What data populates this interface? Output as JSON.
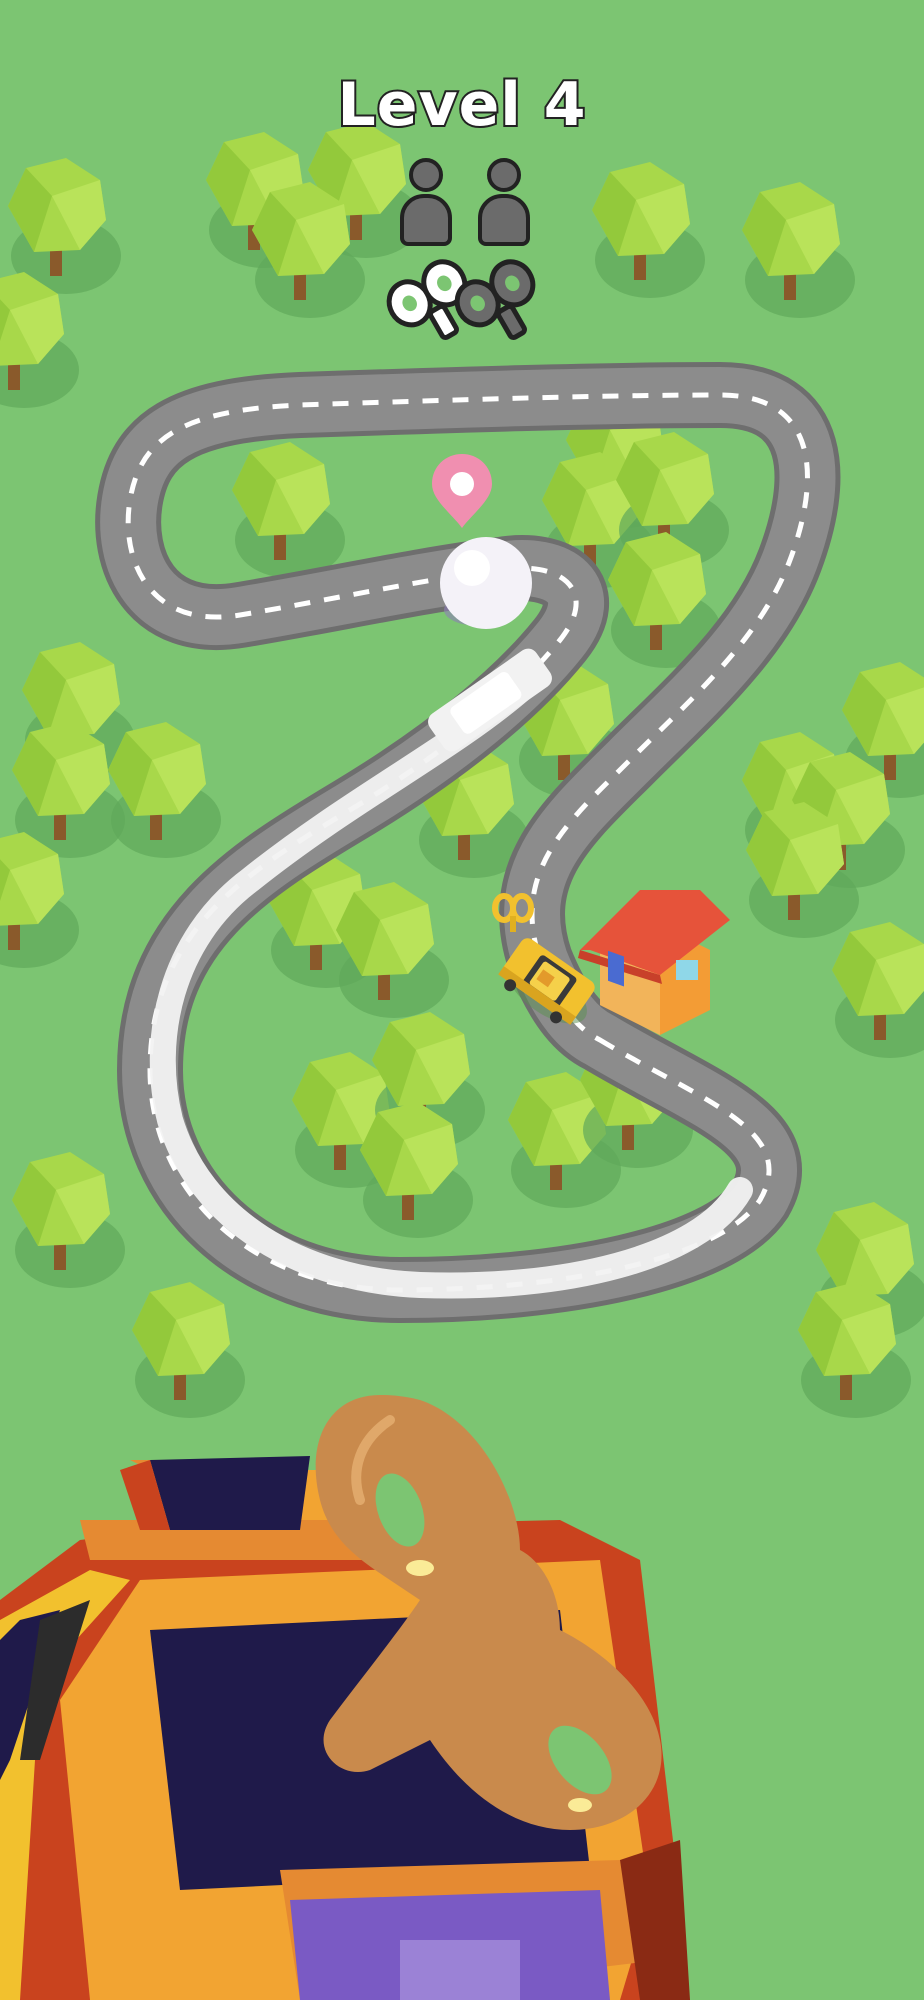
{
  "hud": {
    "level_label": "Level 4",
    "passengers": [
      {
        "icon": "passenger-icon",
        "state": "empty"
      },
      {
        "icon": "passenger-icon",
        "state": "empty"
      }
    ],
    "keys": [
      {
        "icon": "wind-up-key-icon",
        "state": "collected"
      },
      {
        "icon": "wind-up-key-icon",
        "state": "empty"
      }
    ]
  },
  "colors": {
    "grass": "#7cc572",
    "road": "#8c8c8c",
    "road_edge": "#6e6e6e",
    "taxi": "#f2c12e",
    "house_roof": "#e6533a",
    "house_wall": "#f39c35",
    "tree": "#a8d84a",
    "key": "#c98a4c",
    "passenger_slot": "#6b6b6b"
  }
}
